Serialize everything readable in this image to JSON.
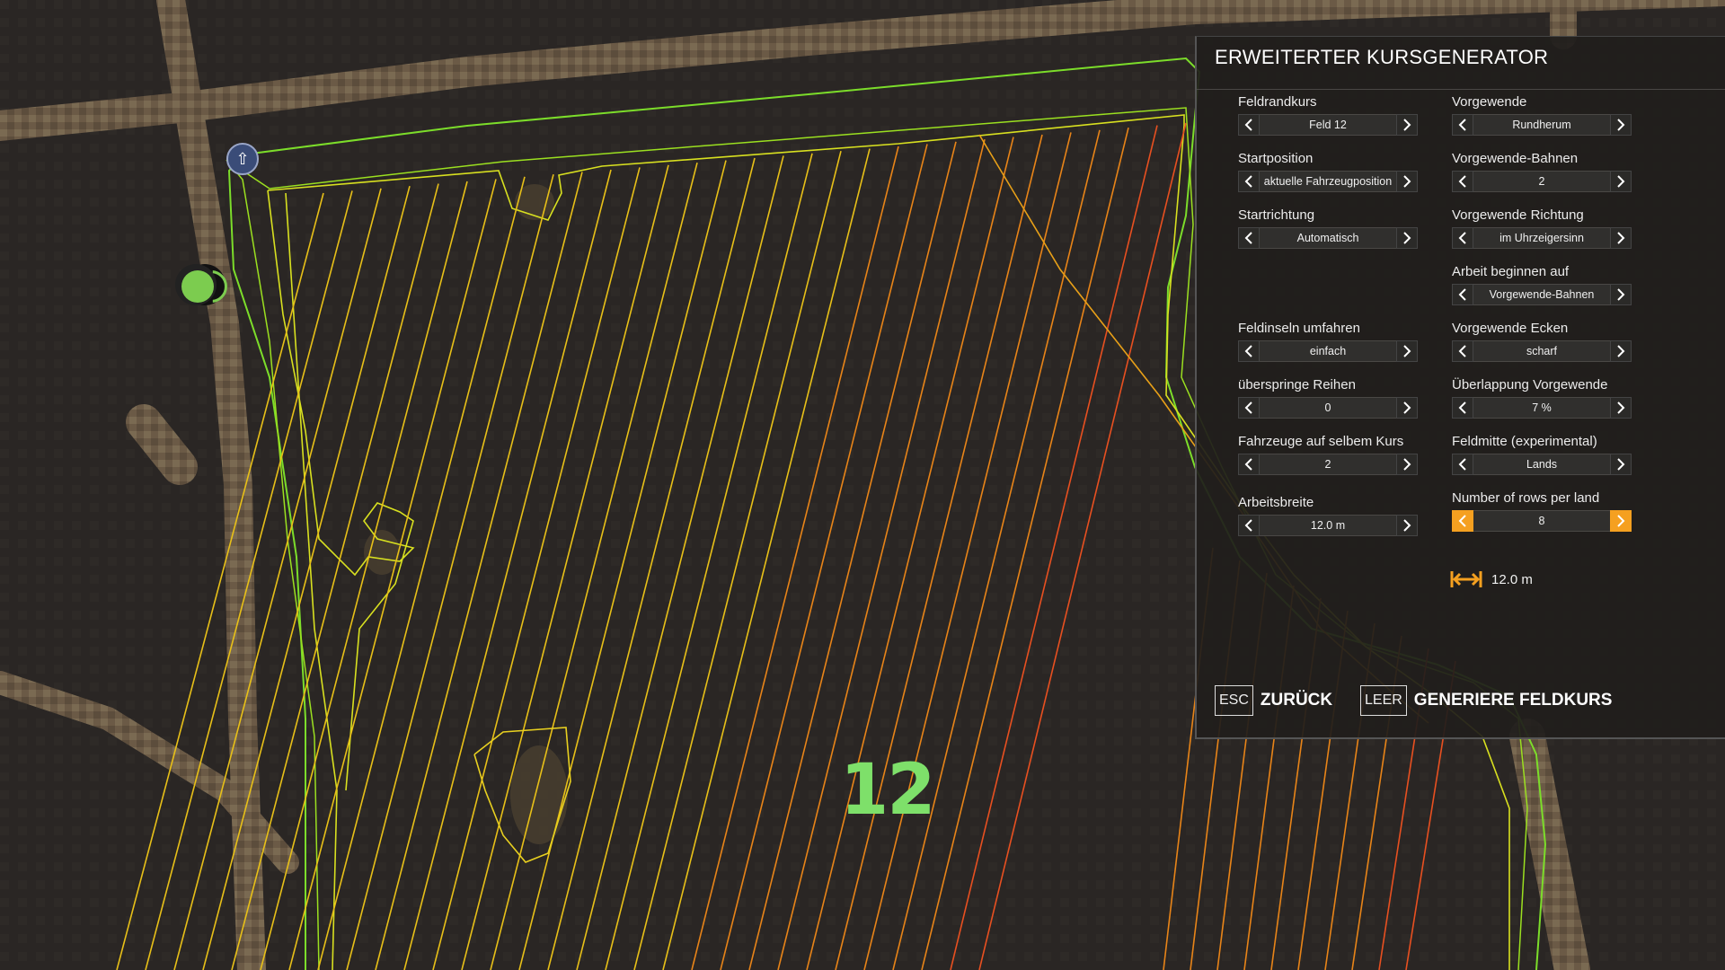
{
  "map": {
    "field_number": "12",
    "start_marker_icon": "arrow-up-icon",
    "vehicle_icon": "vehicle-dot-icon",
    "colors": {
      "boundary": "#7cdd2a",
      "headland": "#d8e020",
      "rows": "#e8c018",
      "rows_late": "#e88418",
      "rows_end": "#e85020"
    }
  },
  "panel": {
    "title": "ERWEITERTER KURSGENERATOR",
    "left_settings": [
      {
        "label": "Feldrandkurs",
        "value": "Feld 12"
      },
      {
        "label": "Startposition",
        "value": "aktuelle Fahrzeugposition"
      },
      {
        "label": "Startrichtung",
        "value": "Automatisch"
      },
      {
        "label": "Feldinseln umfahren",
        "value": "einfach"
      },
      {
        "label": "überspringe Reihen",
        "value": "0"
      },
      {
        "label": "Fahrzeuge auf selbem Kurs",
        "value": "2"
      },
      {
        "label": "Arbeitsbreite",
        "value": "12.0 m"
      }
    ],
    "right_settings": [
      {
        "label": "Vorgewende",
        "value": "Rundherum"
      },
      {
        "label": "Vorgewende-Bahnen",
        "value": "2"
      },
      {
        "label": "Vorgewende Richtung",
        "value": "im Uhrzeigersinn"
      },
      {
        "label": "Arbeit beginnen auf",
        "value": "Vorgewende-Bahnen"
      },
      {
        "label": "Vorgewende Ecken",
        "value": "scharf"
      },
      {
        "label": "Überlappung Vorgewende",
        "value": "7 %"
      },
      {
        "label": "Feldmitte (experimental)",
        "value": "Lands"
      },
      {
        "label": "Number of rows per land",
        "value": "8",
        "active": true
      }
    ],
    "work_width_display": "12.0 m",
    "work_width_icon": "width-arrows-icon",
    "accent_color": "#f5a020",
    "buttons": {
      "back": {
        "key": "ESC",
        "label": "ZURÜCK"
      },
      "generate": {
        "key": "LEER",
        "label": "GENERIERE FELDKURS"
      }
    }
  }
}
